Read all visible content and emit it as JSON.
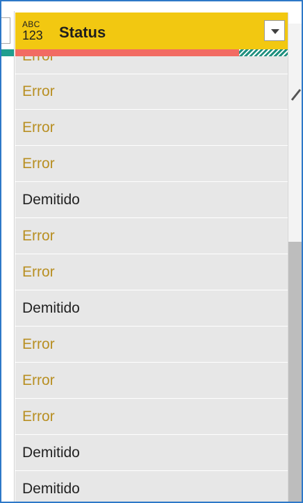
{
  "column": {
    "type_badge": {
      "top": "ABC",
      "bottom": "123"
    },
    "name": "Status",
    "icons": {
      "type": "abc-123-icon",
      "filter": "chevron-down-icon"
    },
    "quality_bar": {
      "error_color": "#f26b63",
      "valid_color": "#20907f"
    }
  },
  "rows": [
    {
      "text": "Error",
      "kind": "error"
    },
    {
      "text": "Error",
      "kind": "error"
    },
    {
      "text": "Error",
      "kind": "error"
    },
    {
      "text": "Error",
      "kind": "error"
    },
    {
      "text": "Demitido",
      "kind": "value"
    },
    {
      "text": "Error",
      "kind": "error"
    },
    {
      "text": "Error",
      "kind": "error"
    },
    {
      "text": "Demitido",
      "kind": "value"
    },
    {
      "text": "Error",
      "kind": "error"
    },
    {
      "text": "Error",
      "kind": "error"
    },
    {
      "text": "Error",
      "kind": "error"
    },
    {
      "text": "Demitido",
      "kind": "value"
    },
    {
      "text": "Demitido",
      "kind": "value"
    }
  ],
  "colors": {
    "header": "#f2c811",
    "error_text": "#b88f22",
    "cell_background": "#e7e7e7",
    "frame": "#2d78c8"
  }
}
